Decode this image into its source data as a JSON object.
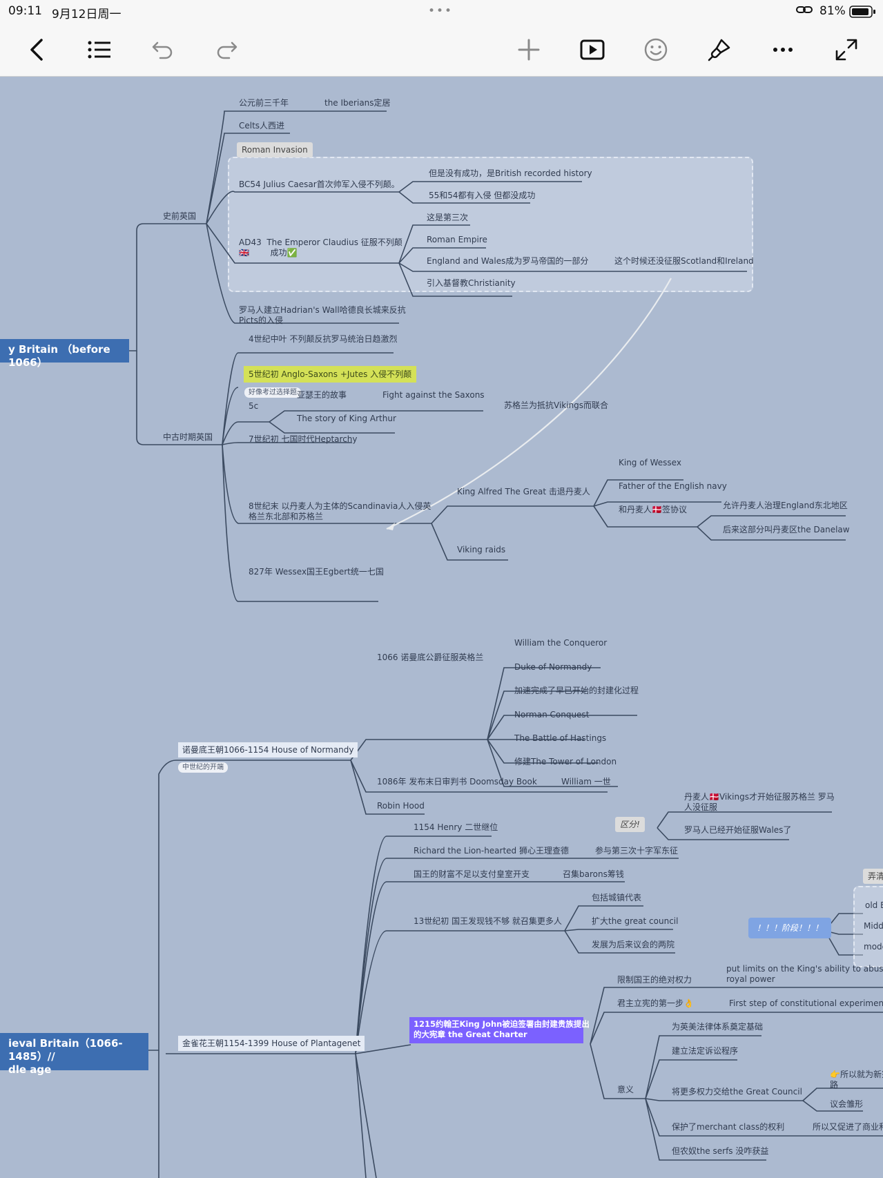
{
  "status": {
    "time": "09:11",
    "date": "9月12日周一",
    "battery": "81%"
  },
  "toolbar": {
    "dots": "•••"
  },
  "roots": {
    "early": "y Britain （before 1066）",
    "medieval": "ieval Britain（1066-1485）//\ndle age"
  },
  "prehistoric": {
    "label": "史前英国",
    "n1": "公元前三千年",
    "n1a": "the Iberians定居",
    "n2": "Celts人西进",
    "boundary_title": "Roman Invasion",
    "bc54": "BC54 Julius Caesar首次帅军入侵不列颠。",
    "bc54a": "但是没有成功，是British recorded history",
    "bc54b": "55和54都有入侵 但都没成功",
    "ad43": "AD43  The Emperor Claudius 征服不列颠\n🇬🇧        成功✅",
    "ad43a": "这是第三次",
    "ad43b": "Roman Empire",
    "ad43c": "England and Wales成为罗马帝国的一部分",
    "ad43c1": "这个时候还没征服Scotland和Ireland",
    "ad43d": "引入基督教Christianity",
    "hadrian": "罗马人建立Hadrian's Wall哈德良长城来反抗\nPicts的入侵"
  },
  "medieval_early": {
    "label": "中古时期英国",
    "c4": "4世纪中叶 不列颠反抗罗马统治日趋激烈",
    "c5": "5世纪初 Anglo-Saxons +Jutes 入侵不列颠",
    "c5_tag": "好像考过选择题",
    "c5c": "5c",
    "arthur1": "亚瑟王的故事",
    "arthur1a": "Fight against the Saxons",
    "arthur2": "The story of King Arthur",
    "scot_note": "苏格兰为抵抗Vikings而联合",
    "c7": "7世纪初 七国时代Heptarchy",
    "c8": "8世纪末 以丹麦人为主体的Scandinavia人入侵英\n格兰东北部和苏格兰",
    "alfred": "King Alfred The Great 击退丹麦人",
    "wessex": "King of Wessex",
    "navy": "Father of the English navy",
    "treaty": "和丹麦人🇩🇰签协议",
    "treaty_a": "允许丹麦人治理England东北地区",
    "treaty_b": "后来这部分叫丹麦区the Danelaw",
    "raids": "Viking raids",
    "c827": "827年 Wessex国王Egbert统一七国"
  },
  "normandy": {
    "label": "诺曼底王朝1066-1154 House of Normandy",
    "tag": "中世纪的开端",
    "conquest": "1066 诺曼底公爵征服英格兰",
    "c1": "William the Conqueror",
    "c2": "Duke of Normandy",
    "c3": "加速完成了早已开始的封建化过程",
    "c4": "Norman Conquest",
    "c5": "The Battle of Hastings",
    "c6": "修建The Tower of London",
    "doomsday": "1086年 发布末日审判书 Doomsday Book",
    "doomsday_a": "William 一世",
    "robin": "Robin Hood",
    "diff_tag": "区分!",
    "diff_a": "丹麦人🇩🇰Vikings才开始征服苏格兰 罗马\n人没征服",
    "diff_b": "罗马人已经开始征服Wales了"
  },
  "plantagenet": {
    "label": "金雀花王朝1154-1399 House of Plantagenet",
    "henry": "1154 Henry 二世继位",
    "richard": "Richard the Lion-hearted 狮心王理查德",
    "richard_a": "参与第三次十字军东征",
    "wealth": "国王的财富不足以支付皇室开支",
    "wealth_a": "召集barons筹钱",
    "c13": "13世纪初 国王发现钱不够 就召集更多人",
    "c13a": "包括城镇代表",
    "c13b": "扩大the great council",
    "c13c": "发展为后来议会的两院",
    "stage_tag": "！！！阶段！！！",
    "side_title": "弄清",
    "side_a": "old E",
    "side_b": "Midd",
    "side_c": "mode",
    "charter": "1215约翰王King John被迫签署由封建贵族提出\n的大宪章 the Great Charter",
    "limit": "限制国王的绝对权力",
    "limit_a": "put limits on the King's ability to abuse his\nroyal power",
    "step": "君主立宪的第一步👌",
    "step_a": "First step of constitutional experiment",
    "meaning": "意义",
    "m1": "为英美法律体系奠定基础",
    "m2": "建立法定诉讼程序",
    "m3": "将更多权力交给the Great Council",
    "m3a": "👉所以就为新兴\n路",
    "m3b": "议会雏形",
    "m4": "保护了merchant class的权利",
    "m4a": "所以又促进了商业和",
    "m5": "但农奴the serfs 没咋获益"
  }
}
